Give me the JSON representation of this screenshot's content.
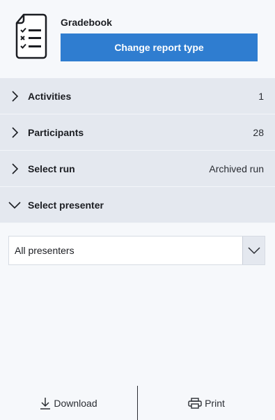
{
  "header": {
    "title": "Gradebook",
    "change_button": "Change report type",
    "icon": "checklist-document-icon"
  },
  "sections": [
    {
      "label": "Activities",
      "value": "1",
      "expanded": false
    },
    {
      "label": "Participants",
      "value": "28",
      "expanded": false
    },
    {
      "label": "Select run",
      "value": "Archived run",
      "expanded": false
    },
    {
      "label": "Select presenter",
      "value": "",
      "expanded": true
    }
  ],
  "presenter_select": {
    "selected": "All presenters"
  },
  "footer": {
    "download_label": "Download",
    "print_label": "Print"
  },
  "colors": {
    "accent": "#2f7dd0",
    "section_bg": "#e4e8ef",
    "page_bg": "#f6f8fb"
  }
}
